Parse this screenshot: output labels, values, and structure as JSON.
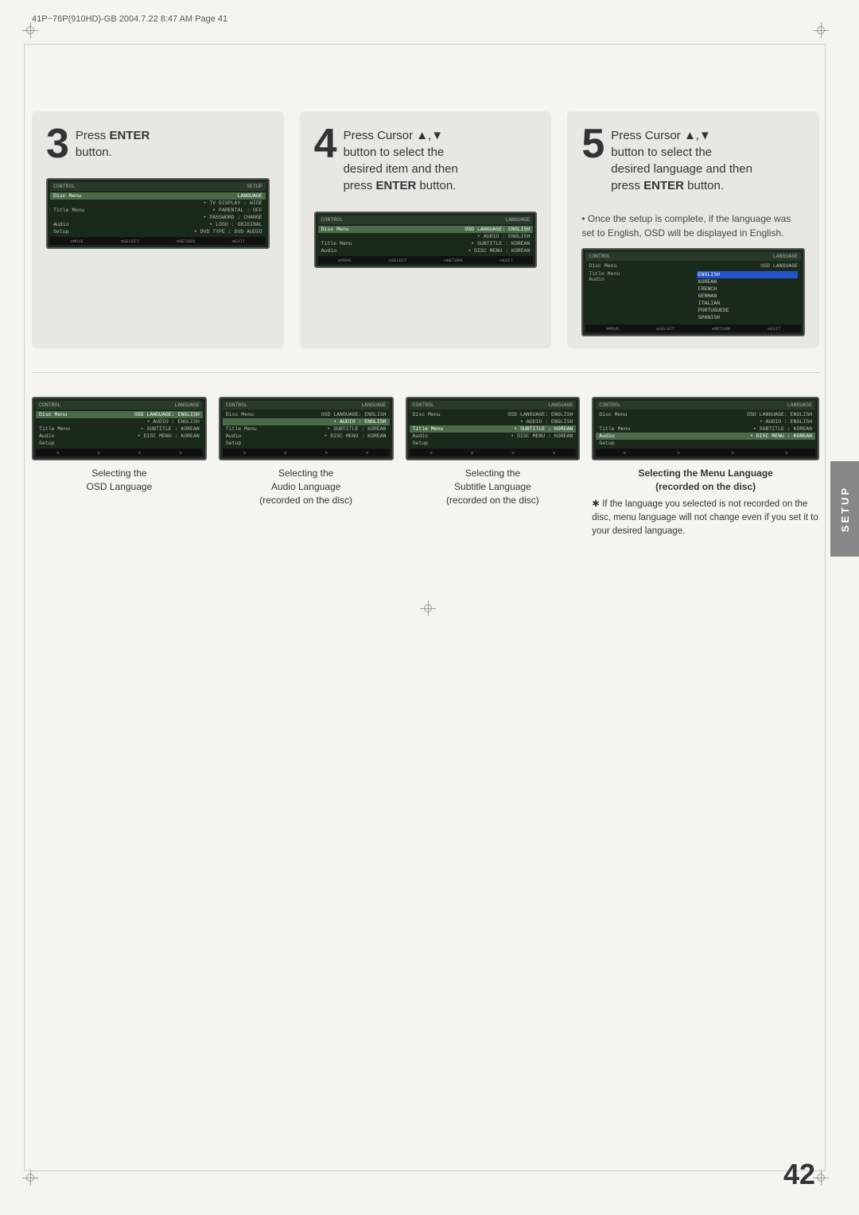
{
  "header": {
    "text": "41P~76P(910HD)-GB   2004.7.22   8:47 AM   Page 41"
  },
  "setup_tab": "SETUP",
  "page_number": "42",
  "steps": [
    {
      "number": "3",
      "text_before": "Press ",
      "bold": "ENTER",
      "text_after": "\nbutton.",
      "screen": {
        "title": "SETUP",
        "header_left": "CONTROL",
        "rows": [
          {
            "left": "Disc Menu",
            "right": "LANGUAGE",
            "highlight": true
          },
          {
            "left": "",
            "right": "• TV DISPLAY : WIDE",
            "highlight": false
          },
          {
            "left": "Title Menu",
            "right": "• PARENTAL : OFF",
            "highlight": false
          },
          {
            "left": "",
            "right": "• PASSWORD : CHANGE",
            "highlight": false
          },
          {
            "left": "Audio",
            "right": "• LOGO : ORIGINAL",
            "highlight": false
          },
          {
            "left": "Setup",
            "right": "• DVD TYPE : DVD AUDIO",
            "highlight": false
          }
        ],
        "footer": [
          "MOVE",
          "SELECT",
          "RETURN",
          "EXIT"
        ]
      }
    },
    {
      "number": "4",
      "text_before": "Press Cursor ▲,▼\nbutton to select the\ndesired item and then\npress ",
      "bold": "ENTER",
      "text_after": " button.",
      "screen": {
        "title": "LANGUAGE",
        "header_left": "CONTROL",
        "rows": [
          {
            "left": "Disc Menu",
            "right": "OSD LANGUAGE: ENGLISH",
            "highlight": true
          },
          {
            "left": "",
            "right": "• AUDIO : ENGLISH",
            "highlight": false
          },
          {
            "left": "Title Menu",
            "right": "• SUBTITLE : KOREAN",
            "highlight": false
          },
          {
            "left": "Audio",
            "right": "• DISC MENU : KOREAN",
            "highlight": false
          }
        ],
        "footer": [
          "MOVE",
          "SELECT",
          "RETURN",
          "EXIT"
        ]
      }
    },
    {
      "number": "5",
      "text_before": "Press Cursor ▲,▼\nbutton to select the\ndesired language and then\npress ",
      "bold": "ENTER",
      "text_after": " button.",
      "note": "• Once the setup is complete, if the language was set to English, OSD will be displayed in English.",
      "screen": {
        "title": "LANGUAGE",
        "header_left": "CONTROL",
        "lang_list": [
          "ENGLISH",
          "KOREAN",
          "FRENCH",
          "GERMAN",
          "ITALIAN",
          "PORTUGUESE",
          "SPANISH"
        ],
        "active": "ENGLISH",
        "footer": [
          "MOVE",
          "SELECT",
          "RETURN",
          "EXIT"
        ]
      }
    }
  ],
  "bottom_items": [
    {
      "label": "Selecting the\nOSD Language",
      "bold": false,
      "note": ""
    },
    {
      "label": "Selecting the\nAudio Language\n(recorded on the disc)",
      "bold": false,
      "note": ""
    },
    {
      "label": "Selecting the\nSubtitle Language\n(recorded on the disc)",
      "bold": false,
      "note": ""
    },
    {
      "label": "Selecting the Menu Language\n(recorded on the disc)",
      "bold": true,
      "note": "* If the language you selected is not recorded on the disc, menu language will not change even if you set it to your desired language."
    }
  ]
}
